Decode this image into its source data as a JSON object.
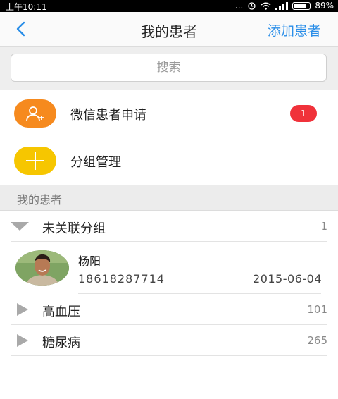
{
  "status_bar": {
    "time": "上午10:11",
    "dots": "...",
    "battery_text": "89%",
    "battery_level": 0.89
  },
  "header": {
    "back_icon": "chevron-left-icon",
    "title": "我的患者",
    "add_label": "添加患者"
  },
  "search": {
    "placeholder": "搜索",
    "value": ""
  },
  "actions": [
    {
      "label": "微信患者申请",
      "icon": "add-user-icon",
      "color": "#f68a1e",
      "badge": "1"
    },
    {
      "label": "分组管理",
      "icon": "plus-icon",
      "color": "#f6c600"
    }
  ],
  "section_title": "我的患者",
  "groups": [
    {
      "name": "未关联分组",
      "count": "1",
      "expanded": true,
      "patients": [
        {
          "name": "杨阳",
          "phone": "18618287714",
          "date": "2015-06-04"
        }
      ]
    },
    {
      "name": "高血压",
      "count": "101",
      "expanded": false
    },
    {
      "name": "糖尿病",
      "count": "265",
      "expanded": false
    }
  ],
  "colors": {
    "accent": "#2a8ee8",
    "badge": "#f0323a"
  }
}
